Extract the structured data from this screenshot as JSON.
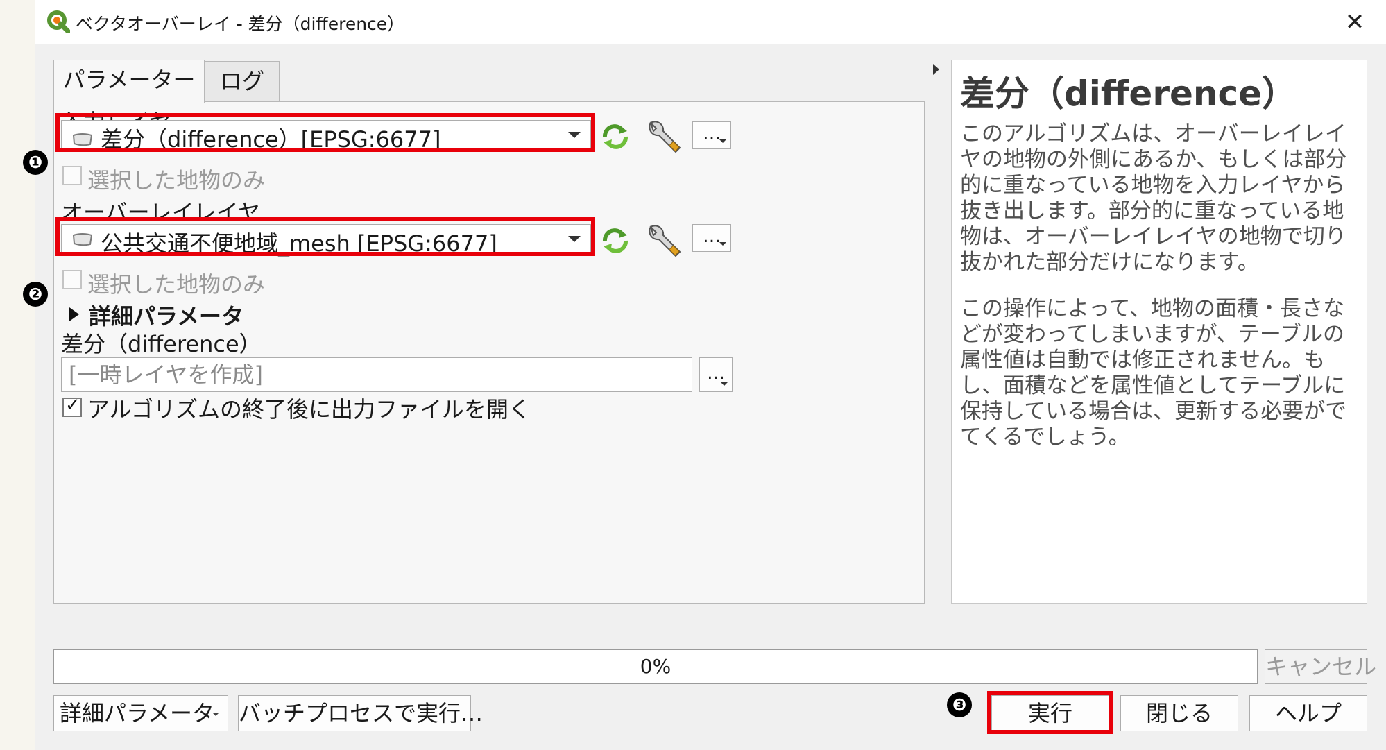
{
  "window": {
    "title": "ベクタオーバーレイ - 差分（difference）",
    "close_label": "✕"
  },
  "tabs": [
    {
      "label": "パラメーター",
      "active": true
    },
    {
      "label": "ログ",
      "active": false
    }
  ],
  "params": {
    "input_layer_label": "入力レイヤ",
    "input_layer_value": "差分（difference）[EPSG:6677]",
    "input_selected_only": "選択した地物のみ",
    "overlay_layer_label": "オーバーレイレイヤ",
    "overlay_layer_value": "公共交通不便地域_mesh [EPSG:6677]",
    "overlay_selected_only": "選択した地物のみ",
    "advanced_label": "詳細パラメータ",
    "output_label": "差分（difference）",
    "output_placeholder": "[一時レイヤを作成]",
    "open_output_label": "アルゴリズムの終了後に出力ファイルを開く",
    "open_output_checked": true,
    "dots_label": "…"
  },
  "help": {
    "title": "差分（difference）",
    "paragraph1": "このアルゴリズムは、オーバーレイレイヤの地物の外側にあるか、もしくは部分的に重なっている地物を入力レイヤから抜き出します。部分的に重なっている地物は、オーバーレイレイヤの地物で切り抜かれた部分だけになります。",
    "paragraph2": "この操作によって、地物の面積・長さなどが変わってしまいますが、テーブルの属性値は自動では修正されません。もし、面積などを属性値としてテーブルに保持している場合は、更新する必要がでてくるでしょう。"
  },
  "progress": {
    "percent": 0,
    "label": "0%"
  },
  "buttons": {
    "cancel": "キャンセル",
    "advanced": "詳細パラメータ",
    "batch": "バッチプロセスで実行…",
    "run": "実行",
    "close": "閉じる",
    "help": "ヘルプ"
  },
  "annotations": {
    "badge1": "❶",
    "badge2": "❷",
    "badge3": "❸",
    "highlight_color": "#e8000a"
  },
  "icons": {
    "app": "qgis-logo-icon",
    "layer": "polygon-layer-icon",
    "iterate": "iterate-icon",
    "settings": "wrench-icon"
  }
}
